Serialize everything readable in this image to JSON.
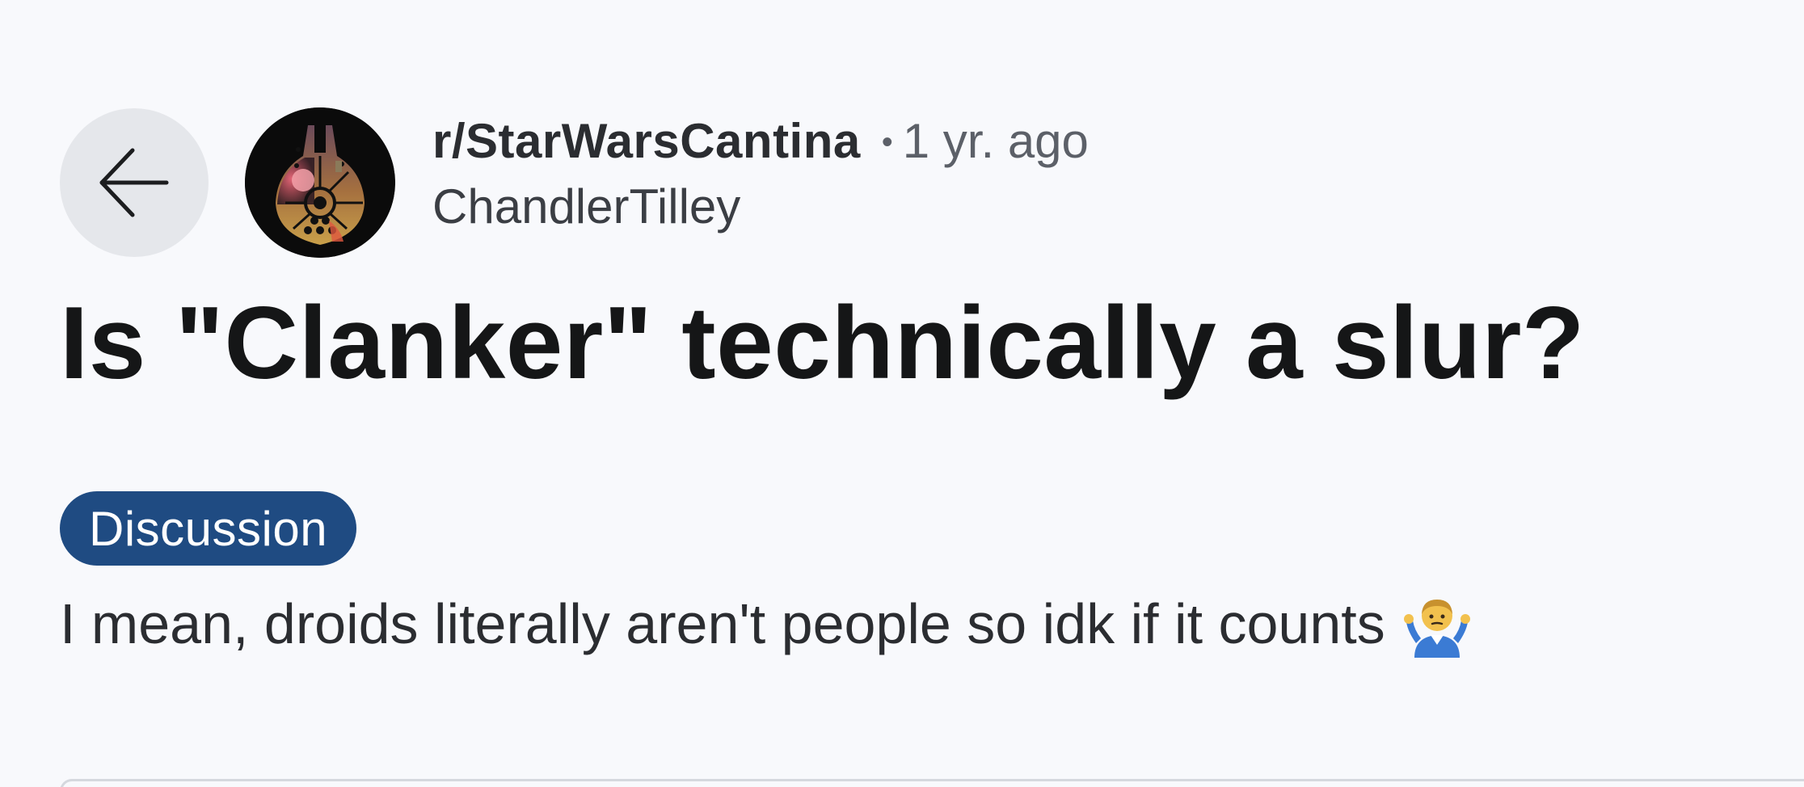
{
  "header": {
    "back_label": "back",
    "subreddit": "r/StarWarsCantina",
    "separator": "•",
    "timestamp": "1 yr. ago",
    "author": "ChandlerTilley"
  },
  "post": {
    "title": "Is \"Clanker\" technically a slur?",
    "flair": "Discussion",
    "body": "I mean, droids literally aren't people so idk if it counts",
    "emoji_icon": "person-shrugging-icon"
  },
  "colors": {
    "background": "#f8f9fc",
    "flair_background": "#1f4b82",
    "back_button_background": "#e5e7eb"
  }
}
